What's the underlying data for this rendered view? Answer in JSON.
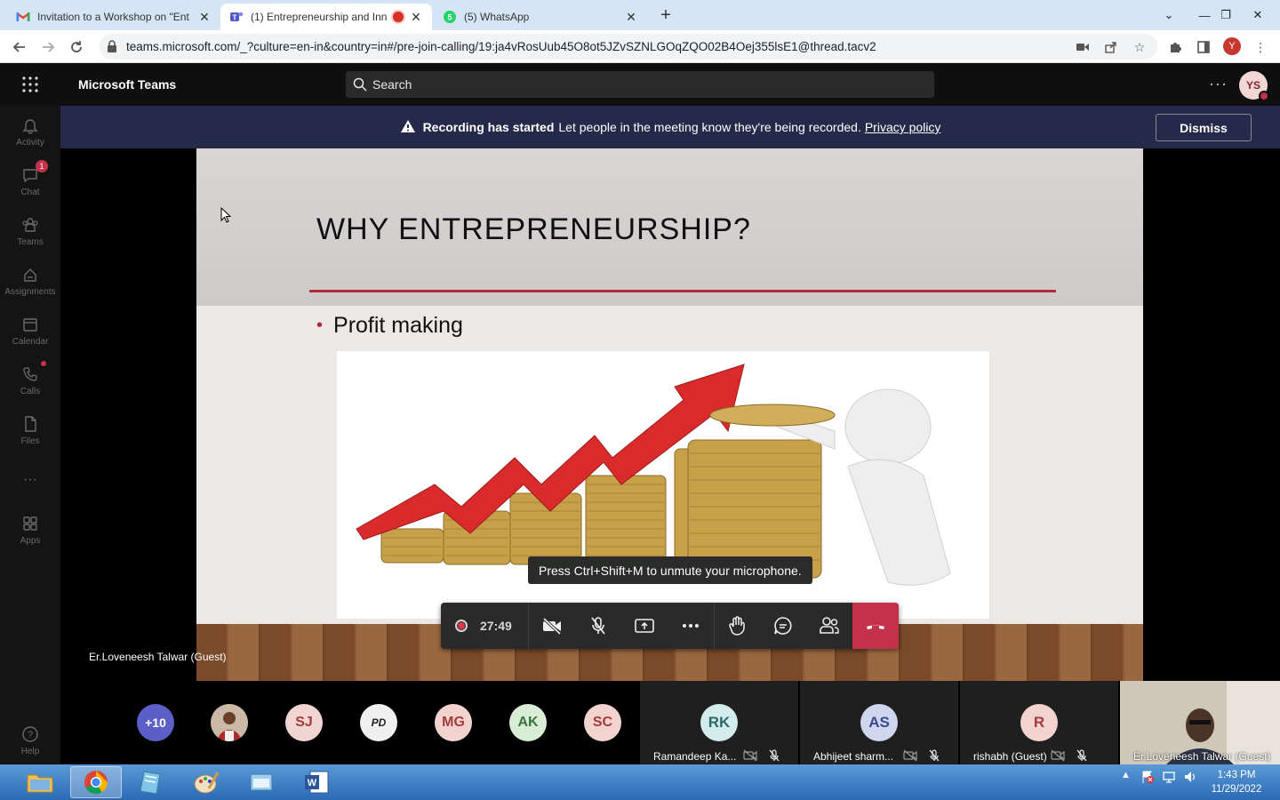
{
  "browser": {
    "tabs": [
      {
        "label": "Invitation to a Workshop on \"Ent",
        "icon": "gmail-icon"
      },
      {
        "label": "(1) Entrepreneurship and Inn",
        "icon": "teams-icon",
        "recording": true
      },
      {
        "label": "(5) WhatsApp",
        "icon": "whatsapp-icon"
      }
    ],
    "url": "teams.microsoft.com/_?culture=en-in&country=in#/pre-join-calling/19:ja4vRosUub45O8ot5JZvSZNLGOqZQO02B4Oej355lsE1@thread.tacv2",
    "profile_initial": "Y"
  },
  "teams": {
    "app_title": "Microsoft Teams",
    "search_placeholder": "Search",
    "user_initials": "YS",
    "rail": [
      {
        "label": "Activity",
        "icon": "bell-icon"
      },
      {
        "label": "Chat",
        "icon": "chat-icon",
        "badge": "1"
      },
      {
        "label": "Teams",
        "icon": "teams-icon"
      },
      {
        "label": "Assignments",
        "icon": "assignments-icon"
      },
      {
        "label": "Calendar",
        "icon": "calendar-icon"
      },
      {
        "label": "Calls",
        "icon": "phone-icon"
      },
      {
        "label": "Files",
        "icon": "file-icon"
      },
      {
        "label": "Apps",
        "icon": "apps-icon"
      },
      {
        "label": "Help",
        "icon": "help-icon"
      }
    ]
  },
  "banner": {
    "bold": "Recording has started",
    "text": "Let people in the meeting know they're being recorded.",
    "link": "Privacy policy",
    "dismiss": "Dismiss"
  },
  "slide": {
    "title": "WHY ENTREPRENEURSHIP?",
    "bullet": "Profit making"
  },
  "stage": {
    "presenter": "Er.Loveneesh Talwar (Guest)",
    "toast": "Press Ctrl+Shift+M to unmute your microphone."
  },
  "controls": {
    "timer": "27:49"
  },
  "participants": {
    "overflow": "+10",
    "avatars": [
      {
        "initials": "",
        "bg": "#8a5a3a",
        "photo": true
      },
      {
        "initials": "SJ",
        "bg": "#f1d5d3",
        "fg": "#a33c3c"
      },
      {
        "initials": "PD",
        "bg": "#f0f0f0",
        "fg": "#222",
        "logo": true
      },
      {
        "initials": "MG",
        "bg": "#f3d3d0",
        "fg": "#a33c3c"
      },
      {
        "initials": "AK",
        "bg": "#d9ecd6",
        "fg": "#39753a"
      },
      {
        "initials": "SC",
        "bg": "#f3d3d0",
        "fg": "#a33c3c"
      }
    ],
    "tiles": [
      {
        "initials": "RK",
        "name": "Ramandeep Ka...",
        "bg": "#d5ecec",
        "fg": "#2c6a6a"
      },
      {
        "initials": "AS",
        "name": "Abhijeet sharm...",
        "bg": "#cfd6ee",
        "fg": "#3a4a8a"
      },
      {
        "initials": "R",
        "name": "rishabh (Guest)",
        "bg": "#f3d3d0",
        "fg": "#a33c3c"
      }
    ],
    "video_name": "Er.Loveneesh Talwar (Guest)"
  },
  "taskbar": {
    "time": "1:43 PM",
    "date": "11/29/2022"
  }
}
